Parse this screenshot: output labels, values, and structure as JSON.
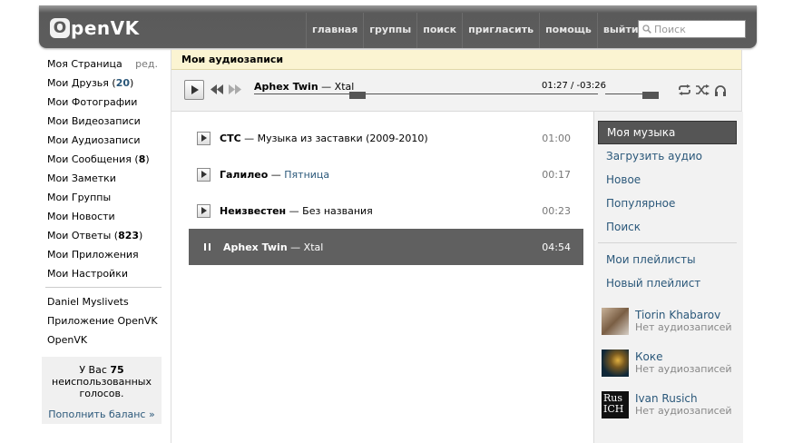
{
  "header": {
    "logo_initial": "O",
    "logo_rest": "penVK",
    "nav": [
      "главная",
      "группы",
      "поиск",
      "пригласить",
      "помощь",
      "выйти"
    ],
    "search_placeholder": "Поиск"
  },
  "sidebar": {
    "items": [
      {
        "label": "Моя Страница",
        "extra": "ред."
      },
      {
        "label": "Мои Друзья",
        "count": "20"
      },
      {
        "label": "Мои Фотографии"
      },
      {
        "label": "Мои Видеозаписи"
      },
      {
        "label": "Мои Аудиозаписи"
      },
      {
        "label": "Мои Сообщения",
        "count": "8"
      },
      {
        "label": "Мои Заметки"
      },
      {
        "label": "Мои Группы"
      },
      {
        "label": "Мои Новости"
      },
      {
        "label": "Мои Ответы",
        "count": "823"
      },
      {
        "label": "Мои Приложения"
      },
      {
        "label": "Мои Настройки"
      }
    ],
    "links": [
      "Daniel Myslivets",
      "Приложение OpenVK",
      "OpenVK"
    ],
    "votes": {
      "pre": "У Вас ",
      "count": "75",
      "post": "неиспользованных голосов.",
      "link": "Пополнить баланс »"
    }
  },
  "page": {
    "title": "Мои аудиозаписи"
  },
  "player": {
    "artist": "Aphex Twin",
    "sep": " — ",
    "title": "Xtal",
    "time": "01:27 / -03:26",
    "progress_fraction": 0.3,
    "volume_fraction": 0.85
  },
  "tracks": [
    {
      "artist": "СТС",
      "title": "Музыка из заставки (2009-2010)",
      "duration": "01:00",
      "title_link": false
    },
    {
      "artist": "Галилео",
      "title": "Пятница",
      "duration": "00:17",
      "title_link": true
    },
    {
      "artist": "Неизвестен",
      "title": "Без названия",
      "duration": "00:23",
      "title_link": false
    },
    {
      "artist": "Aphex Twin",
      "title": "Xtal",
      "duration": "04:54",
      "active": true
    }
  ],
  "right_panel": {
    "selected": "Моя музыка",
    "links": [
      "Загрузить аудио",
      "Новое",
      "Популярное",
      "Поиск"
    ],
    "playlist_links": [
      "Мои плейлисты",
      "Новый плейлист"
    ],
    "friends": [
      {
        "name": "Tiorin Khabarov",
        "status": "Нет аудиозаписей"
      },
      {
        "name": "Коке",
        "status": "Нет аудиозаписей"
      },
      {
        "name": "Ivan Rusich",
        "status": "Нет аудиозаписей",
        "avatar_text": "Rus ICH"
      }
    ]
  },
  "colors": {
    "header": "#5d5d5d",
    "link": "#2B587A",
    "page_title_bg": "#fbf4d2",
    "active_row": "#606060"
  }
}
